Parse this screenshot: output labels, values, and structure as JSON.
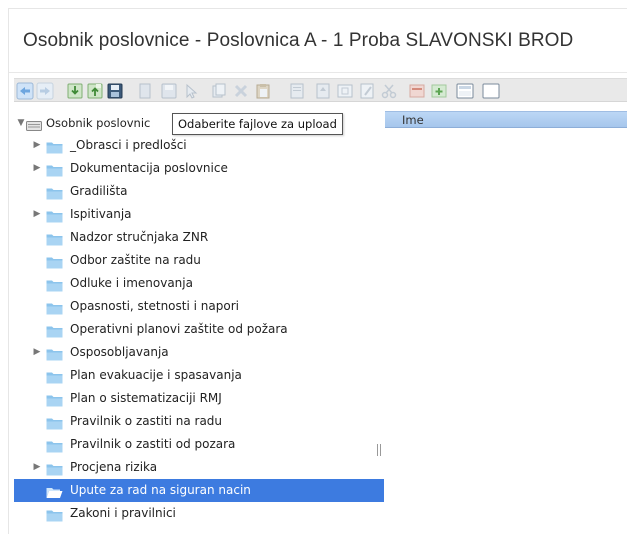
{
  "window": {
    "title": "Osobnik poslovnice - Poslovnica A - 1 Proba SLAVONSKI BROD"
  },
  "toolbar": {
    "buttons": [
      {
        "icon": "arrow-left-icon"
      },
      {
        "icon": "arrow-right-icon"
      },
      {
        "icon": "download-icon"
      },
      {
        "icon": "upload-icon"
      },
      {
        "icon": "save-icon"
      },
      {
        "icon": "new-doc-icon"
      },
      {
        "icon": "save-disabled-icon"
      },
      {
        "icon": "select-icon"
      },
      {
        "icon": "copy-icon"
      },
      {
        "icon": "delete-icon"
      },
      {
        "icon": "paste-icon"
      },
      {
        "icon": "properties-icon"
      },
      {
        "icon": "document-icon"
      },
      {
        "icon": "frame-icon"
      },
      {
        "icon": "edit-icon"
      },
      {
        "icon": "cut-icon"
      },
      {
        "icon": "insert-icon"
      },
      {
        "icon": "add-row-icon"
      },
      {
        "icon": "table-icon"
      },
      {
        "icon": "more-icon"
      }
    ]
  },
  "tooltip": {
    "text": "Odaberite fajlove za upload"
  },
  "tree": {
    "root_label": "Osobnik poslovnic",
    "items": [
      {
        "label": "_Obrasci i predlošci",
        "expandable": true,
        "selected": false
      },
      {
        "label": "Dokumentacija poslovnice",
        "expandable": true,
        "selected": false
      },
      {
        "label": "Gradilišta",
        "expandable": false,
        "selected": false
      },
      {
        "label": "Ispitivanja",
        "expandable": true,
        "selected": false
      },
      {
        "label": "Nadzor stručnjaka ZNR",
        "expandable": false,
        "selected": false
      },
      {
        "label": "Odbor zaštite na radu",
        "expandable": false,
        "selected": false
      },
      {
        "label": "Odluke i imenovanja",
        "expandable": false,
        "selected": false
      },
      {
        "label": "Opasnosti, stetnosti i napori",
        "expandable": false,
        "selected": false
      },
      {
        "label": "Operativni planovi zaštite od požara",
        "expandable": false,
        "selected": false
      },
      {
        "label": "Osposobljavanja",
        "expandable": true,
        "selected": false
      },
      {
        "label": "Plan evakuacije i spasavanja",
        "expandable": false,
        "selected": false
      },
      {
        "label": "Plan o sistematizaciji RMJ",
        "expandable": false,
        "selected": false
      },
      {
        "label": "Pravilnik o zastiti na radu",
        "expandable": false,
        "selected": false
      },
      {
        "label": "Pravilnik o zastiti od pozara",
        "expandable": false,
        "selected": false
      },
      {
        "label": "Procjena rizika",
        "expandable": true,
        "selected": false
      },
      {
        "label": "Upute za rad na siguran nacin",
        "expandable": false,
        "selected": true
      },
      {
        "label": "Zakoni i pravilnici",
        "expandable": false,
        "selected": false
      }
    ]
  },
  "grid": {
    "columns": [
      "Ime"
    ]
  },
  "colors": {
    "selection": "#3d7be0",
    "folder": "#8cc4ec",
    "header": "#b3d0f2"
  }
}
